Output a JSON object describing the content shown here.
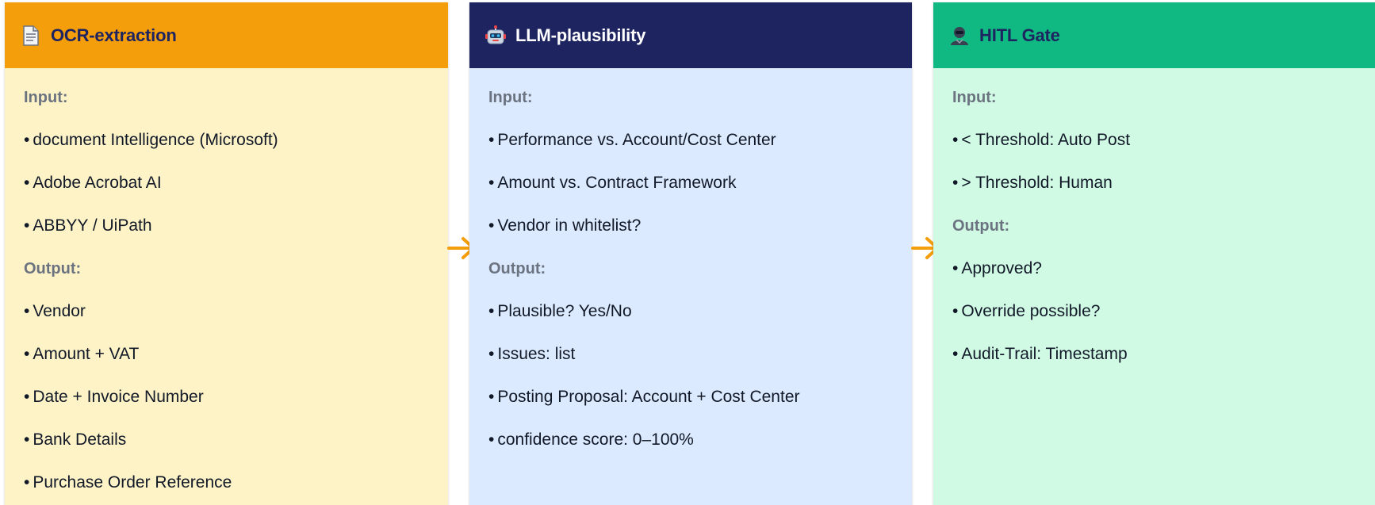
{
  "cards": [
    {
      "title": "OCR-extraction",
      "icon": "document-icon",
      "input_label": "Input:",
      "inputs": [
        "document Intelligence (Microsoft)",
        "Adobe Acrobat AI",
        "ABBYY / UiPath"
      ],
      "output_label": "Output:",
      "outputs": [
        "Vendor",
        "Amount + VAT",
        "Date + Invoice Number",
        "Bank Details",
        "Purchase Order Reference"
      ]
    },
    {
      "title": "LLM-plausibility",
      "icon": "robot-icon",
      "input_label": "Input:",
      "inputs": [
        "Performance vs. Account/Cost Center",
        "Amount vs. Contract Framework",
        "Vendor in whitelist?"
      ],
      "output_label": "Output:",
      "outputs": [
        "Plausible? Yes/No",
        "Issues: list",
        "Posting Proposal: Account + Cost Center",
        "confidence score: 0–100%"
      ]
    },
    {
      "title": "HITL Gate",
      "icon": "person-icon",
      "input_label": "Input:",
      "inputs": [
        "< Threshold: Auto Post",
        "> Threshold: Human"
      ],
      "output_label": "Output:",
      "outputs": [
        "Approved?",
        "Override possible?",
        "Audit-Trail: Timestamp"
      ]
    }
  ],
  "colors": {
    "ocr_header": "#f59e0b",
    "ocr_body": "#fef3c7",
    "llm_header": "#1e2460",
    "llm_body": "#dbeafe",
    "hitl_header": "#10b981",
    "hitl_body": "#d1fae5",
    "arrow": "#f59e0b"
  }
}
